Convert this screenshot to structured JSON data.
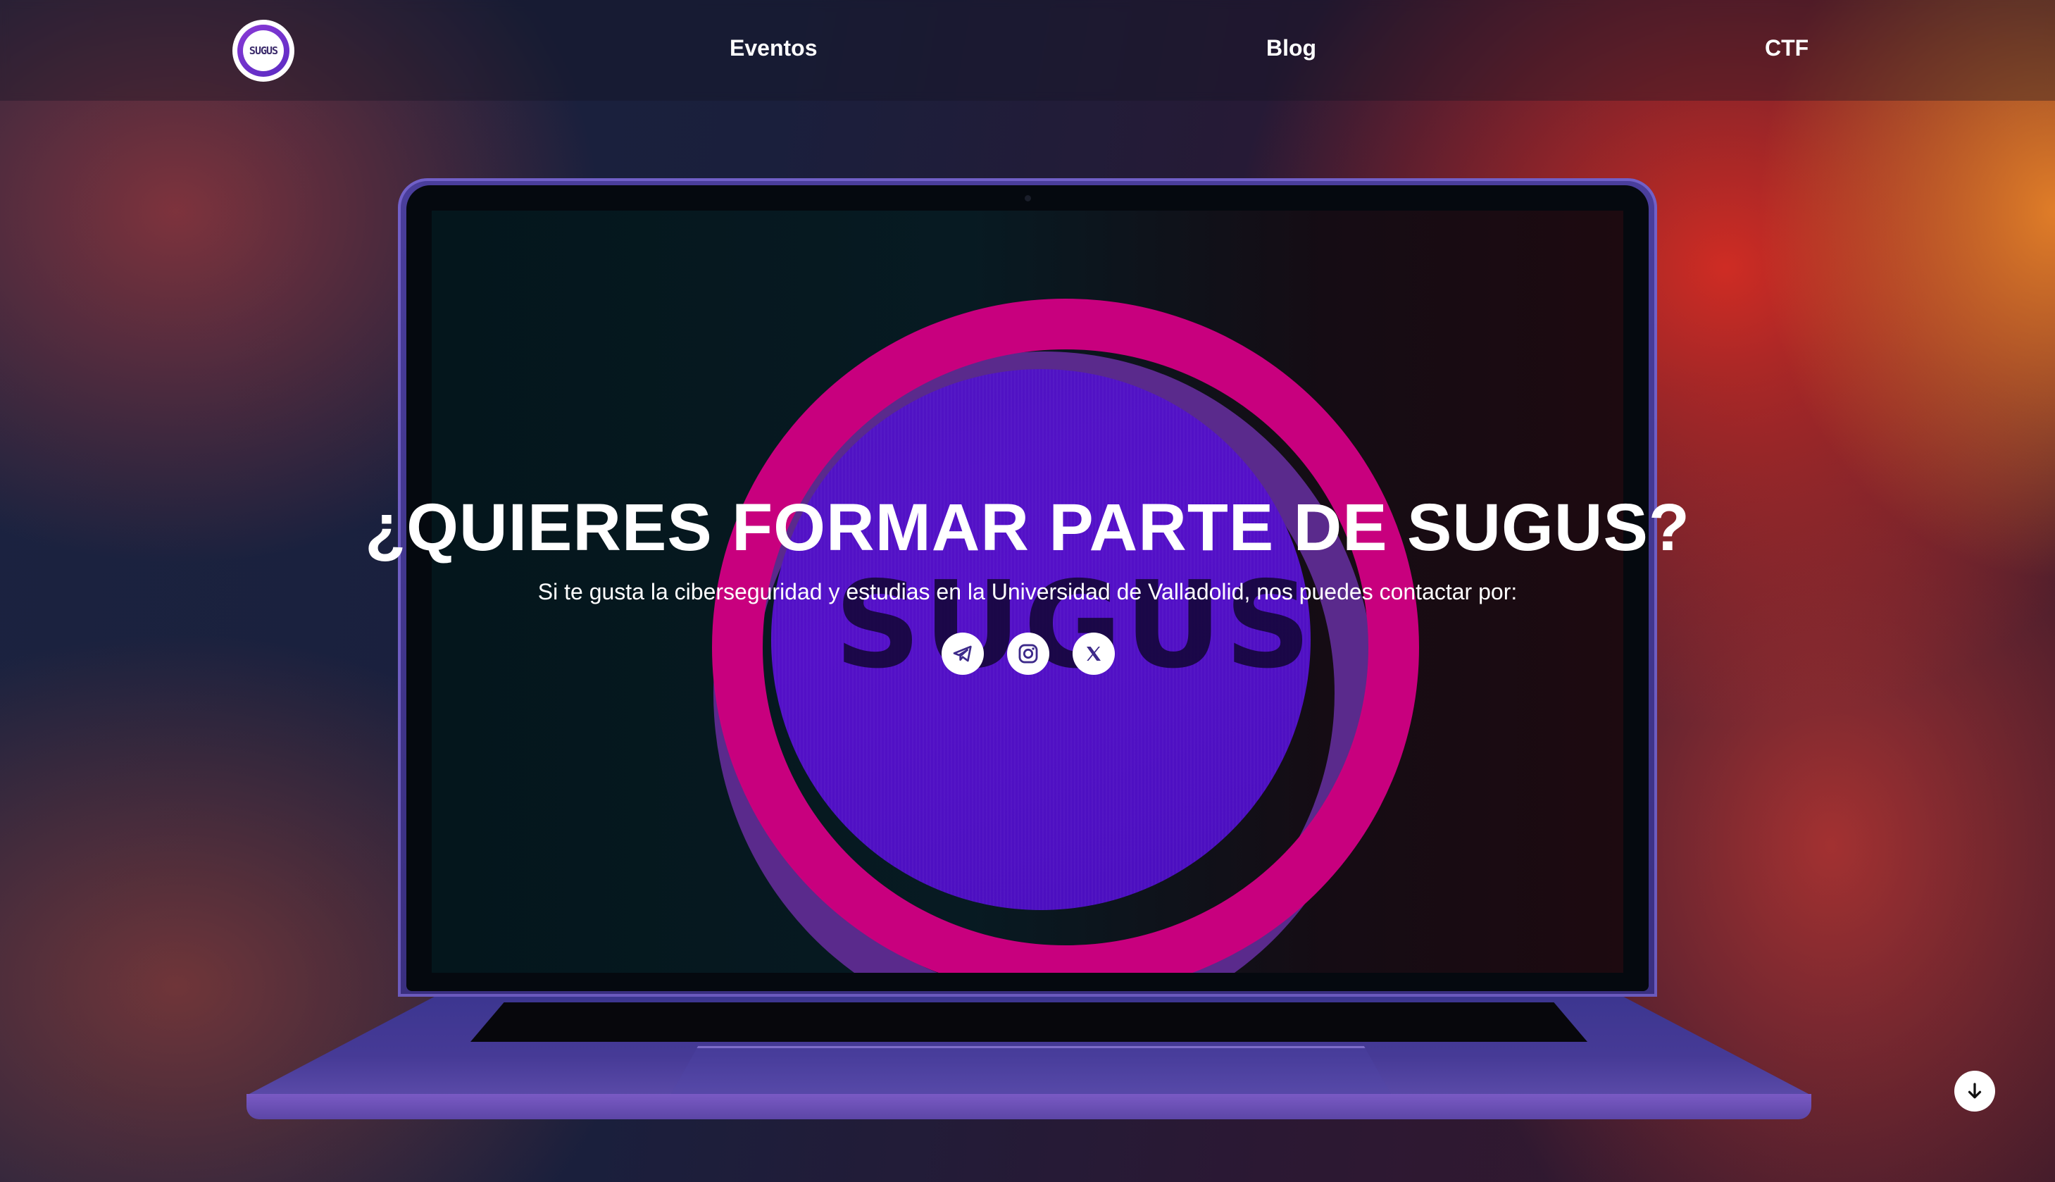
{
  "brand": {
    "logo_text": "SUGUS",
    "logo_icon": "sugus-logo-icon"
  },
  "nav": {
    "items": [
      {
        "label": "Eventos"
      },
      {
        "label": "Blog"
      },
      {
        "label": "CTF"
      }
    ]
  },
  "hero": {
    "title": "¿QUIERES FORMAR PARTE DE SUGUS?",
    "subtitle": "Si te gusta la ciberseguridad y estudias en la Universidad de Valladolid, nos puedes contactar por:",
    "screen_logo_text": "SUGUS"
  },
  "socials": [
    {
      "icon": "telegram-icon"
    },
    {
      "icon": "instagram-icon"
    },
    {
      "icon": "x-icon"
    }
  ],
  "scroll": {
    "icon": "arrow-down-icon"
  },
  "colors": {
    "ring": "#c8007e",
    "disc": "#4e14c2",
    "laptop": "#4a3e9c",
    "icon_dark": "#3d2a8a"
  }
}
